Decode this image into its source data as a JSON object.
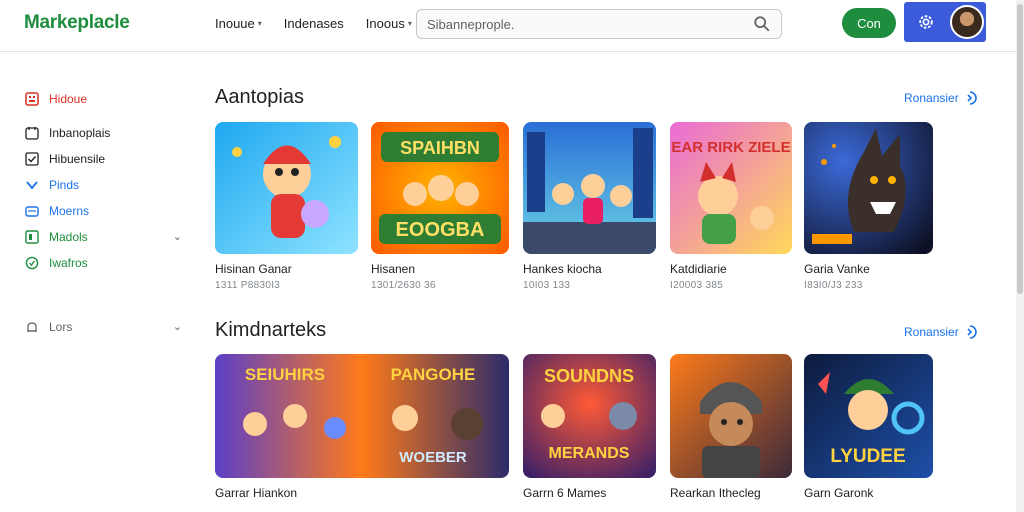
{
  "header": {
    "logo": "Markeplacle",
    "nav": [
      {
        "label": "Inouue",
        "dropdown": true
      },
      {
        "label": "Indenases",
        "dropdown": false
      },
      {
        "label": "Inoous",
        "dropdown": true
      }
    ],
    "search_placeholder": "Sibanneprople.",
    "cta_label": "Con"
  },
  "sidebar": {
    "items": [
      {
        "label": "Hidoue",
        "icon": "grid-icon",
        "color": "#d93025"
      },
      {
        "label": "Inbanoplais",
        "icon": "folder-icon",
        "color": "#202124"
      },
      {
        "label": "Hibuensile",
        "icon": "checkbox-icon",
        "color": "#202124"
      },
      {
        "label": "Pinds",
        "icon": "chevron-down-icon",
        "color": "#1a73e8"
      },
      {
        "label": "Moerns",
        "icon": "card-icon",
        "color": "#1a73e8"
      },
      {
        "label": "Madols",
        "icon": "box-icon",
        "color": "#1e8e3e"
      },
      {
        "label": "Iwafros",
        "icon": "clock-icon",
        "color": "#1e8e3e"
      },
      {
        "label": "Lors",
        "icon": "bell-icon",
        "color": "#5f6368"
      }
    ]
  },
  "sections": [
    {
      "title": "Aantopias",
      "see_more": "Ronansier",
      "cards": [
        {
          "title": "Hisinan Ganar",
          "meta": "1311 P8830I3",
          "art": "Red jester hero",
          "bg1": "#1fa8f0",
          "bg2": "#62d2ff",
          "fg": "#e53935"
        },
        {
          "title": "Hisanen",
          "meta": "1301/2630 36",
          "art": "SPAIHBN EOOGBA",
          "bg1": "#ff6a00",
          "bg2": "#ffb300",
          "fg": "#2e7d32"
        },
        {
          "title": "Hankes kiocha",
          "meta": "10I03 133",
          "art": "City runners",
          "bg1": "#2a6fd6",
          "bg2": "#6bd4e6",
          "fg": "#e91e63"
        },
        {
          "title": "Katdidiarie",
          "meta": "I20003 385",
          "art": "EAR RIRK ZIELE",
          "bg1": "#e96bd6",
          "bg2": "#ffd85a",
          "fg": "#d32f2f"
        },
        {
          "title": "Garia Vanke",
          "meta": "I83I0/J3 233",
          "art": "Werewolf",
          "bg1": "#1b1f3b",
          "bg2": "#3b4a8a",
          "fg": "#ff9800"
        }
      ]
    },
    {
      "title": "Kimdnarteks",
      "see_more": "Ronansier",
      "cards": [
        {
          "title": "Garrar Hiankon",
          "meta": "",
          "art": "SEIUHIRS PANGOHE WOEBER",
          "bg1": "#5a3fc8",
          "bg2": "#ff7a1a",
          "fg": "#ffd23f"
        },
        {
          "title": "Garrn 6 Mames",
          "meta": "",
          "art": "SOUNDNS MERANDS",
          "bg1": "#2b1b6b",
          "bg2": "#ff5a36",
          "fg": "#ffd23f"
        },
        {
          "title": "Rearkan Ithecleg",
          "meta": "",
          "art": "Helmet warrior",
          "bg1": "#ff7a1a",
          "bg2": "#3a2a3a",
          "fg": "#555"
        },
        {
          "title": "Garn Garonk",
          "meta": "",
          "art": "LYUDEE",
          "bg1": "#0d1b3d",
          "bg2": "#1e4fa8",
          "fg": "#ffd23f"
        }
      ]
    }
  ]
}
